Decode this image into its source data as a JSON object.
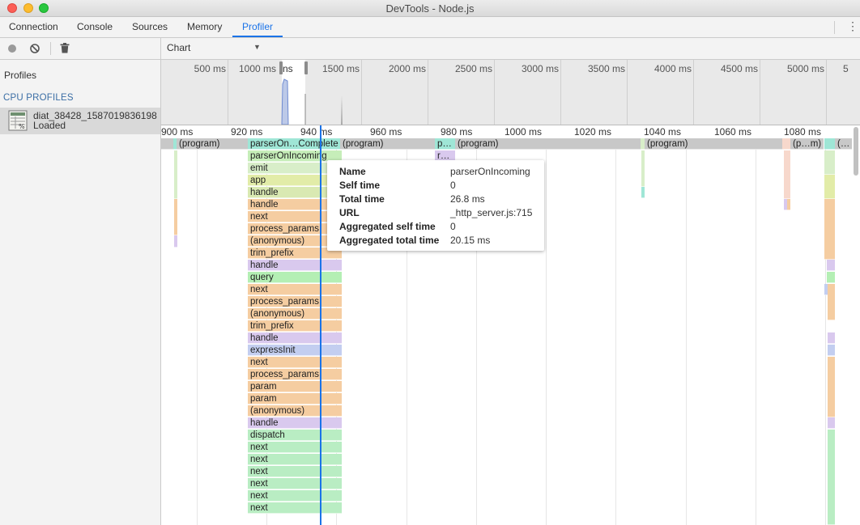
{
  "window": {
    "title": "DevTools - Node.js"
  },
  "tabs": [
    {
      "label": "Connection"
    },
    {
      "label": "Console"
    },
    {
      "label": "Sources"
    },
    {
      "label": "Memory"
    },
    {
      "label": "Profiler",
      "active": true
    }
  ],
  "toolbar": {
    "view_select": "Chart"
  },
  "sidebar": {
    "profiles_label": "Profiles",
    "section_label": "CPU PROFILES",
    "profile": {
      "name": "diat_38428_1587019836198",
      "status": "Loaded"
    }
  },
  "overview": {
    "ticks": [
      "500 ms",
      "1000 ms",
      "1500 ms",
      "2000 ms",
      "2500 ms",
      "3000 ms",
      "3500 ms",
      "4000 ms",
      "4500 ms",
      "5000 ms",
      "5"
    ],
    "window_label": "ns"
  },
  "ruler": {
    "ticks": [
      "900 ms",
      "920 ms",
      "940 ms",
      "960 ms",
      "980 ms",
      "1000 ms",
      "1020 ms",
      "1040 ms",
      "1060 ms",
      "1080 ms"
    ]
  },
  "flame": {
    "row0": {
      "program_1": "(program)",
      "stack_top": "parserOn…Complete",
      "program_2": "(program)",
      "p_short": "p…",
      "program_3": "(program)",
      "program_4": "(program)",
      "pm": "(p…m)",
      "ellipsis": "(…"
    },
    "row1_short": "r…",
    "stack": [
      "parserOnIncoming",
      "emit",
      "app",
      "handle",
      "handle",
      "next",
      "process_params",
      "(anonymous)",
      "trim_prefix",
      "handle",
      "query",
      "next",
      "process_params",
      "(anonymous)",
      "trim_prefix",
      "handle",
      "expressInit",
      "next",
      "process_params",
      "param",
      "param",
      "(anonymous)",
      "handle",
      "dispatch",
      "next",
      "next",
      "next",
      "next",
      "next",
      "next"
    ]
  },
  "tooltip": {
    "rows": [
      {
        "key": "Name",
        "value": "parserOnIncoming"
      },
      {
        "key": "Self time",
        "value": "0"
      },
      {
        "key": "Total time",
        "value": "26.8 ms"
      },
      {
        "key": "URL",
        "value": "_http_server.js:715"
      },
      {
        "key": "Aggregated self time",
        "value": "0"
      },
      {
        "key": "Aggregated total time",
        "value": "20.15 ms"
      }
    ]
  },
  "colors": {
    "accent": "#1a73e8"
  }
}
